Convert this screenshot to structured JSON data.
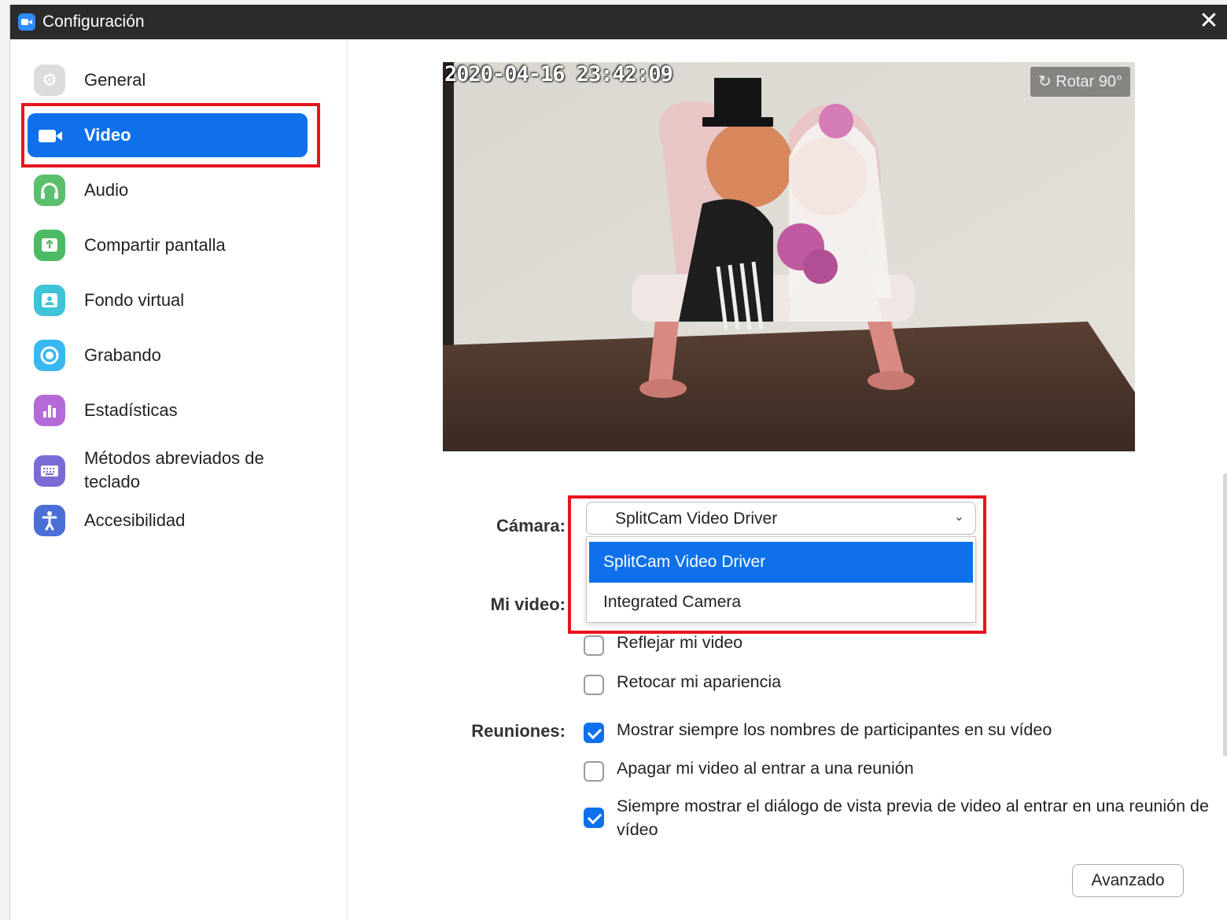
{
  "window": {
    "title": "Configuración",
    "close_icon": "close-icon"
  },
  "sidebar": {
    "items": [
      {
        "label": "General",
        "icon": "gear-icon",
        "color": "#d9d9d9"
      },
      {
        "label": "Video",
        "icon": "video-camera-icon",
        "color": "#0e71eb",
        "active": true
      },
      {
        "label": "Audio",
        "icon": "headphones-icon",
        "color": "#5cbf6e"
      },
      {
        "label": "Compartir pantalla",
        "icon": "share-screen-icon",
        "color": "#4cbb64"
      },
      {
        "label": "Fondo virtual",
        "icon": "virtual-background-icon",
        "color": "#3fc3d9"
      },
      {
        "label": "Grabando",
        "icon": "record-icon",
        "color": "#39b7f0"
      },
      {
        "label": "Estadísticas",
        "icon": "statistics-icon",
        "color": "#b56ad8"
      },
      {
        "label": "Métodos abreviados de teclado",
        "icon": "keyboard-icon",
        "color": "#7a6cd6"
      },
      {
        "label": "Accesibilidad",
        "icon": "accessibility-icon",
        "color": "#4b6fd6"
      }
    ]
  },
  "preview": {
    "timestamp": "2020-04-16 23:42:09",
    "rotate_label": "Rotar 90°",
    "rotate_icon": "rotate-icon"
  },
  "camera": {
    "label": "Cámara:",
    "selected": "SplitCam Video Driver",
    "options": [
      "SplitCam Video Driver",
      "Integrated Camera"
    ]
  },
  "my_video": {
    "label": "Mi video:",
    "options": [
      {
        "label": "Reflejar mi video",
        "checked": false
      },
      {
        "label": "Retocar mi apariencia",
        "checked": false
      }
    ]
  },
  "meetings": {
    "label": "Reuniones:",
    "options": [
      {
        "label": "Mostrar siempre los nombres de participantes en su vídeo",
        "checked": true
      },
      {
        "label": "Apagar mi video al entrar a una reunión",
        "checked": false
      },
      {
        "label": "Siempre mostrar el diálogo de vista previa de video al entrar en una reunión de vídeo",
        "checked": true
      }
    ]
  },
  "advanced_button": "Avanzado",
  "colors": {
    "accent": "#0e71eb",
    "highlight_box": "#e8141c",
    "titlebar": "#2b2b2b"
  }
}
